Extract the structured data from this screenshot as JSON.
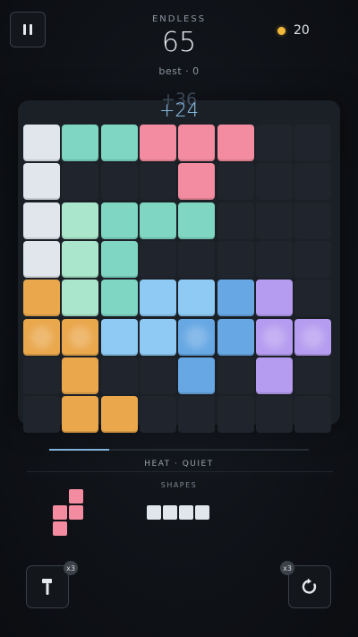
{
  "header": {
    "mode": "ENDLESS",
    "score": "65",
    "best": "best · 0",
    "coins": "20",
    "gain_ghost": "+36",
    "gain": "+24"
  },
  "colors": {
    "white": "#e1e6ec",
    "mint": "#7ed6c3",
    "mint_light": "#a9e6cb",
    "pink": "#f38ca0",
    "orange": "#eaa74c",
    "sky": "#8ecaf4",
    "blue": "#67a8e4",
    "purple": "#b69cf0",
    "empty": "#20252d"
  },
  "board": {
    "rows": 8,
    "cols": 8,
    "grid": [
      [
        "white",
        "mint",
        "mint",
        "pink",
        "pink",
        "pink",
        null,
        null
      ],
      [
        "white",
        null,
        null,
        null,
        "pink",
        null,
        null,
        null
      ],
      [
        "white",
        "mint_light",
        "mint",
        "mint",
        "mint",
        null,
        null,
        null
      ],
      [
        "white",
        "mint_light",
        "mint",
        null,
        null,
        null,
        null,
        null
      ],
      [
        "orange",
        "mint_light",
        "mint",
        "sky",
        "sky",
        "blue",
        "purple",
        null
      ],
      [
        "orange",
        "orange",
        "sky",
        "sky",
        "blue",
        "blue",
        "purple",
        "purple"
      ],
      [
        null,
        "orange",
        null,
        null,
        "blue",
        null,
        "purple",
        null
      ],
      [
        null,
        "orange",
        "orange",
        null,
        null,
        null,
        null,
        null
      ]
    ],
    "glow": [
      [
        5,
        0
      ],
      [
        5,
        1
      ],
      [
        5,
        4
      ],
      [
        5,
        6
      ],
      [
        5,
        7
      ]
    ]
  },
  "status": {
    "heat": "HEAT · QUIET",
    "progress": 0.23,
    "shapes_label": "SHAPES"
  },
  "pieces": [
    {
      "name": "pink-s-piece",
      "color": "#f38ca0",
      "cells": [
        [
          0,
          1
        ],
        [
          1,
          0
        ],
        [
          1,
          1
        ],
        [
          2,
          0
        ]
      ]
    },
    {
      "name": "white-i-piece",
      "color": "#e1e6ec",
      "cells": [
        [
          0,
          0
        ],
        [
          0,
          1
        ],
        [
          0,
          2
        ],
        [
          0,
          3
        ]
      ]
    }
  ],
  "tools": {
    "hammer_count": "x3",
    "undo_count": "x3"
  }
}
